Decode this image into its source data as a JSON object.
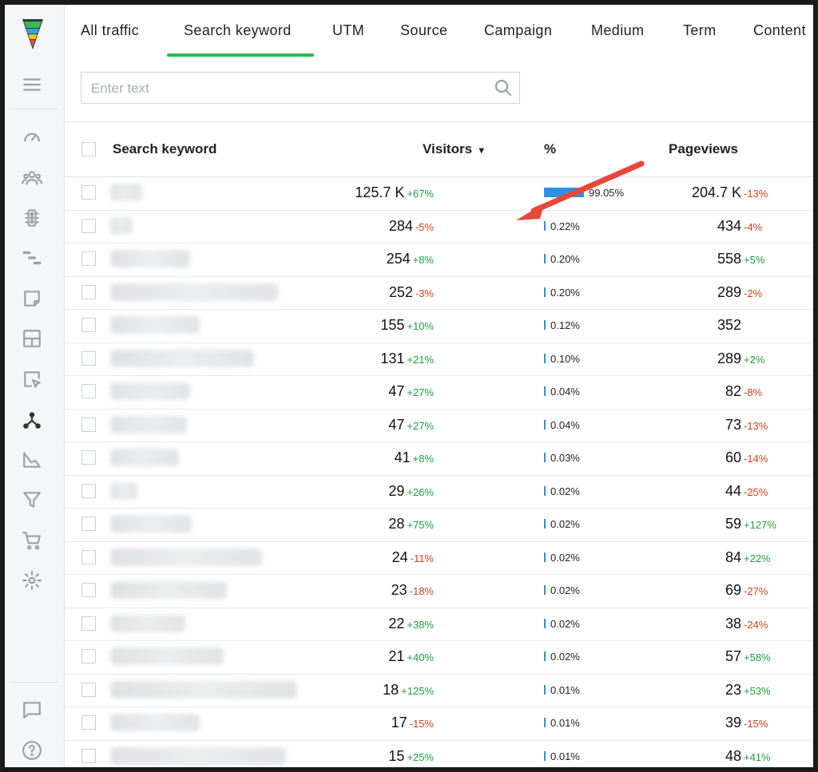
{
  "tabs": [
    "All traffic",
    "Search keyword",
    "UTM",
    "Source",
    "Campaign",
    "Medium",
    "Term",
    "Content"
  ],
  "active_tab": "Search keyword",
  "search": {
    "placeholder": "Enter text"
  },
  "table": {
    "columns": {
      "keyword": "Search keyword",
      "visitors": "Visitors",
      "sort_indicator": "▾",
      "percent": "%",
      "pageviews": "Pageviews"
    },
    "rows": [
      {
        "visitors": "125.7 K",
        "visitors_change": "+67%",
        "percent": "99.05%",
        "share": 0.9905,
        "pageviews": "204.7 K",
        "pageviews_change": "-13%"
      },
      {
        "visitors": "284",
        "visitors_change": "-5%",
        "percent": "0.22%",
        "share": 0.0022,
        "pageviews": "434",
        "pageviews_change": "-4%"
      },
      {
        "visitors": "254",
        "visitors_change": "+8%",
        "percent": "0.20%",
        "share": 0.002,
        "pageviews": "558",
        "pageviews_change": "+5%"
      },
      {
        "visitors": "252",
        "visitors_change": "-3%",
        "percent": "0.20%",
        "share": 0.002,
        "pageviews": "289",
        "pageviews_change": "-2%"
      },
      {
        "visitors": "155",
        "visitors_change": "+10%",
        "percent": "0.12%",
        "share": 0.0012,
        "pageviews": "352",
        "pageviews_change": ""
      },
      {
        "visitors": "131",
        "visitors_change": "+21%",
        "percent": "0.10%",
        "share": 0.001,
        "pageviews": "289",
        "pageviews_change": "+2%"
      },
      {
        "visitors": "47",
        "visitors_change": "+27%",
        "percent": "0.04%",
        "share": 0.0004,
        "pageviews": "82",
        "pageviews_change": "-8%"
      },
      {
        "visitors": "47",
        "visitors_change": "+27%",
        "percent": "0.04%",
        "share": 0.0004,
        "pageviews": "73",
        "pageviews_change": "-13%"
      },
      {
        "visitors": "41",
        "visitors_change": "+8%",
        "percent": "0.03%",
        "share": 0.0003,
        "pageviews": "60",
        "pageviews_change": "-14%"
      },
      {
        "visitors": "29",
        "visitors_change": "+26%",
        "percent": "0.02%",
        "share": 0.0002,
        "pageviews": "44",
        "pageviews_change": "-25%"
      },
      {
        "visitors": "28",
        "visitors_change": "+75%",
        "percent": "0.02%",
        "share": 0.0002,
        "pageviews": "59",
        "pageviews_change": "+127%"
      },
      {
        "visitors": "24",
        "visitors_change": "-11%",
        "percent": "0.02%",
        "share": 0.0002,
        "pageviews": "84",
        "pageviews_change": "+22%"
      },
      {
        "visitors": "23",
        "visitors_change": "-18%",
        "percent": "0.02%",
        "share": 0.0002,
        "pageviews": "69",
        "pageviews_change": "-27%"
      },
      {
        "visitors": "22",
        "visitors_change": "+38%",
        "percent": "0.02%",
        "share": 0.0002,
        "pageviews": "38",
        "pageviews_change": "-24%"
      },
      {
        "visitors": "21",
        "visitors_change": "+40%",
        "percent": "0.02%",
        "share": 0.0002,
        "pageviews": "57",
        "pageviews_change": "+58%"
      },
      {
        "visitors": "18",
        "visitors_change": "+125%",
        "percent": "0.01%",
        "share": 0.0001,
        "pageviews": "23",
        "pageviews_change": "+53%"
      },
      {
        "visitors": "17",
        "visitors_change": "-15%",
        "percent": "0.01%",
        "share": 0.0001,
        "pageviews": "39",
        "pageviews_change": "-15%"
      },
      {
        "visitors": "15",
        "visitors_change": "+25%",
        "percent": "0.01%",
        "share": 0.0001,
        "pageviews": "48",
        "pageviews_change": "+41%"
      }
    ]
  },
  "sidebar_icons": [
    "menu-icon",
    "dashboard-icon",
    "visitors-icon",
    "traffic-light-icon",
    "funnel-steps-icon",
    "notes-icon",
    "layout-icon",
    "click-heatmap-icon",
    "sources-icon",
    "chart-icon",
    "filter-icon",
    "cart-icon",
    "settings-icon",
    "chat-icon",
    "help-icon"
  ],
  "colors": {
    "accent_green": "#19c24a",
    "positive": "#1e9d3b",
    "negative": "#d0401f",
    "bar": "#2c8fe6",
    "annotation_arrow": "#e8473a"
  }
}
